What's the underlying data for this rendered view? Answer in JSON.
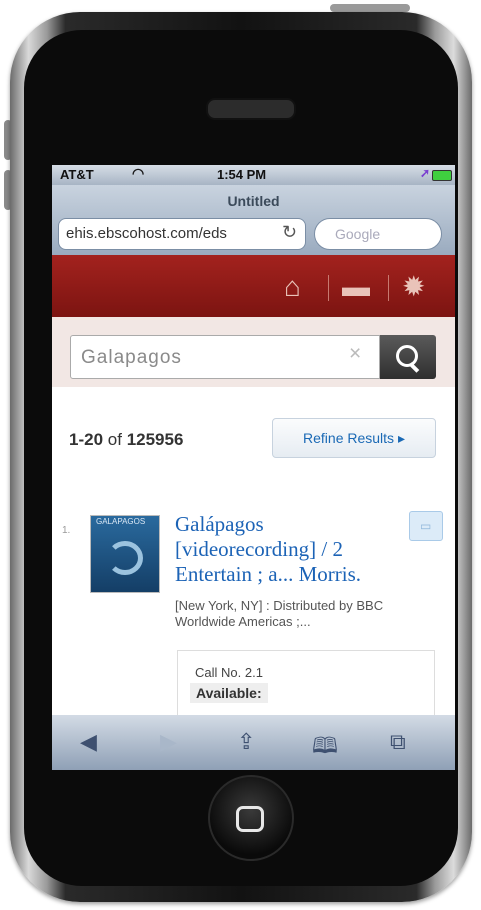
{
  "status_bar": {
    "carrier": "AT&T",
    "time": "1:54 PM"
  },
  "browser": {
    "page_title": "Untitled",
    "url": "ehis.ebscohost.com/eds",
    "search_placeholder": "Google"
  },
  "search": {
    "query": "Galapagos"
  },
  "results": {
    "range": "1-20",
    "of_label": "of",
    "total": "125956",
    "refine_label": "Refine Results ▸"
  },
  "result_item": {
    "index": "1.",
    "cover_text": "GALAPAGOS",
    "title": "Galápagos [videorecording] / 2 Entertain ; a... Morris.",
    "publisher": "[New York, NY] : Distributed by BBC Worldwide Americas ;...",
    "call_no": "Call No. 2.1",
    "availability": "Available:"
  },
  "icons": {
    "home": "⌂",
    "folder": "▬",
    "settings": "✹",
    "back": "◀",
    "forward": "▶",
    "share": "⇪",
    "bookmarks": "🕮",
    "pages": "⧉"
  },
  "colors": {
    "header_red": "#8f1a16",
    "link_blue": "#1c63b6"
  }
}
